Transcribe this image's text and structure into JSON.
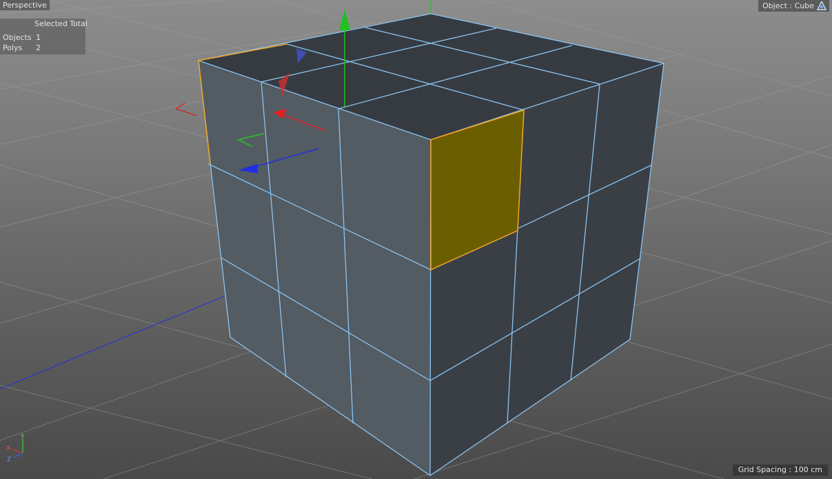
{
  "viewport": {
    "view_name": "Perspective",
    "object_label": "Object : Cube",
    "camera_icon": "camera-icon",
    "grid_spacing": "Grid Spacing : 100 cm"
  },
  "stats": {
    "header": "Selected Total",
    "rows": [
      {
        "label": "Objects",
        "value": "1"
      },
      {
        "label": "Polys",
        "value": "2"
      }
    ]
  },
  "axis": {
    "x": "X",
    "y": "Y",
    "z": "Z"
  },
  "colors": {
    "background_top": "#8d8d8d",
    "background_bottom": "#4a4a4a",
    "grid_line": "#a3a3a3",
    "cube_front": "#535b63",
    "cube_side": "#3a3f46",
    "cube_top": "#363b42",
    "edge": "#8cc4f0",
    "selected_poly": "#6b5e00",
    "selected_edge": "#f5a623",
    "axis_x": "#e02020",
    "axis_y": "#20c020",
    "axis_z": "#2030e0"
  }
}
